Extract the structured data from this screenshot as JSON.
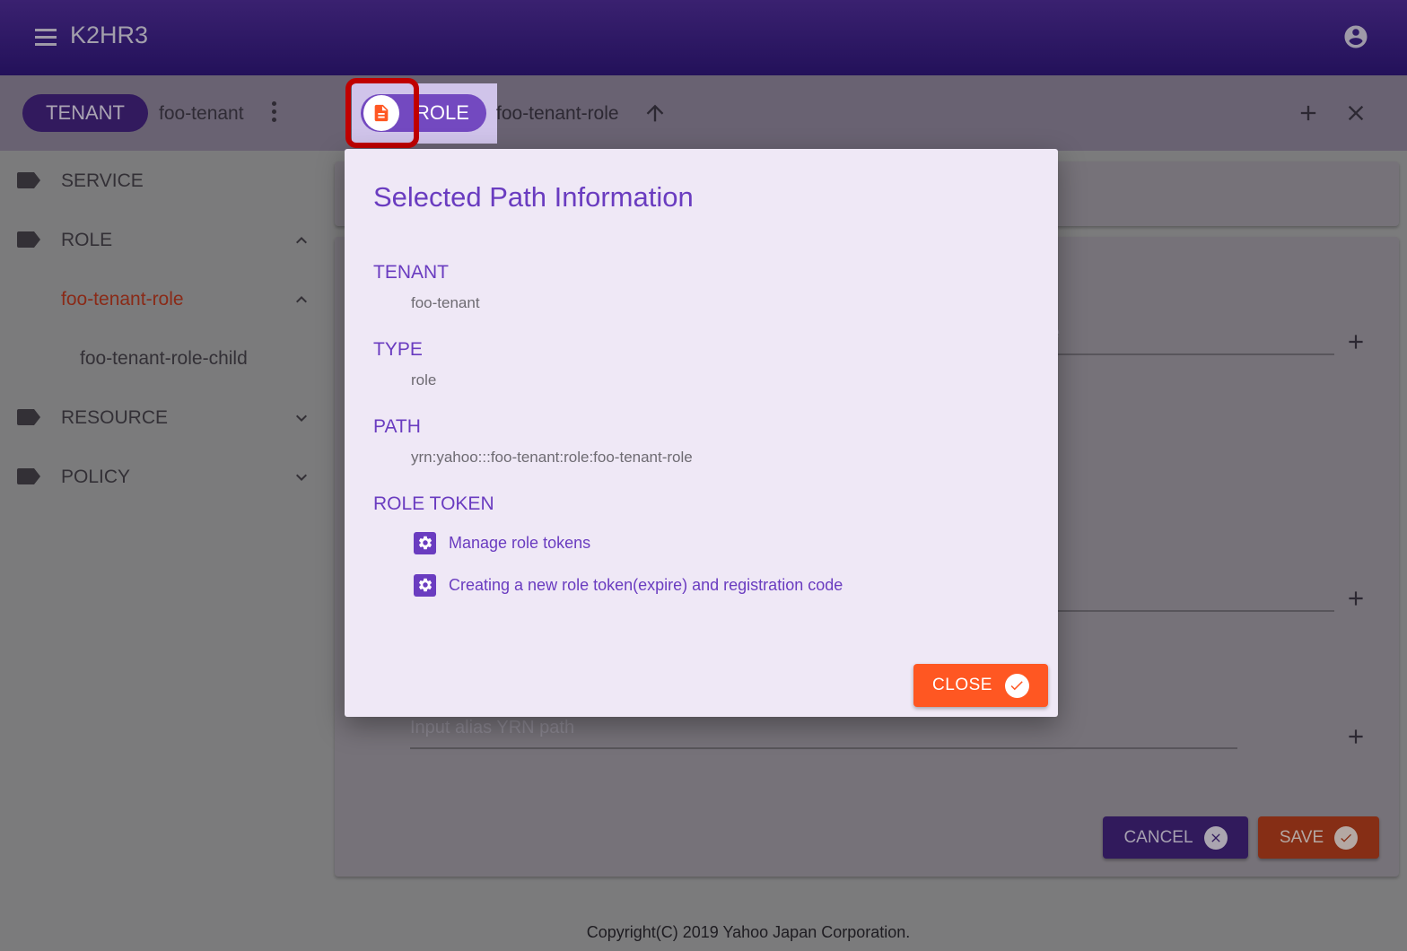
{
  "app": {
    "title": "K2HR3",
    "menu_icon": "hamburger-menu-icon",
    "account_icon": "account-circle-icon"
  },
  "toolbar": {
    "tenant_chip": "TENANT",
    "tenant_name": "foo-tenant",
    "role_chip": "ROLE",
    "role_name": "foo-tenant-role",
    "icons": [
      "more-vert-icon",
      "document-icon",
      "arrow-up-icon",
      "add-icon",
      "close-icon"
    ]
  },
  "sidebar": {
    "items": [
      {
        "label": "SERVICE",
        "icon": "label-icon",
        "expand": null
      },
      {
        "label": "ROLE",
        "icon": "label-icon",
        "expand": "chevron-up"
      },
      {
        "label": "foo-tenant-role",
        "expand": "chevron-up",
        "selected": true
      },
      {
        "label": "foo-tenant-role-child"
      },
      {
        "label": "RESOURCE",
        "icon": "label-icon",
        "expand": "chevron-down"
      },
      {
        "label": "POLICY",
        "icon": "label-icon",
        "expand": "chevron-down"
      }
    ]
  },
  "main": {
    "field1_placeholder_fragment": "e",
    "alias_placeholder": "Input alias YRN path",
    "cancel_label": "CANCEL",
    "save_label": "SAVE"
  },
  "dialog": {
    "title": "Selected Path Information",
    "sections": [
      {
        "heading": "TENANT",
        "value": "foo-tenant"
      },
      {
        "heading": "TYPE",
        "value": "role"
      },
      {
        "heading": "PATH",
        "value": "yrn:yahoo:::foo-tenant:role:foo-tenant-role"
      },
      {
        "heading": "ROLE TOKEN"
      }
    ],
    "token_links": [
      {
        "label": "Manage role tokens",
        "icon": "settings-icon"
      },
      {
        "label": "Creating a new role token(expire) and registration code",
        "icon": "settings-icon"
      }
    ],
    "close_label": "CLOSE"
  },
  "footer": {
    "copyright": "Copyright(C) 2019 Yahoo Japan Corporation."
  },
  "colors": {
    "primary": "#6a3cc0",
    "appbar": "#23115a",
    "accent": "#ff5722",
    "dialog_bg": "#efe8f6",
    "highlight_box": "#c00000"
  }
}
